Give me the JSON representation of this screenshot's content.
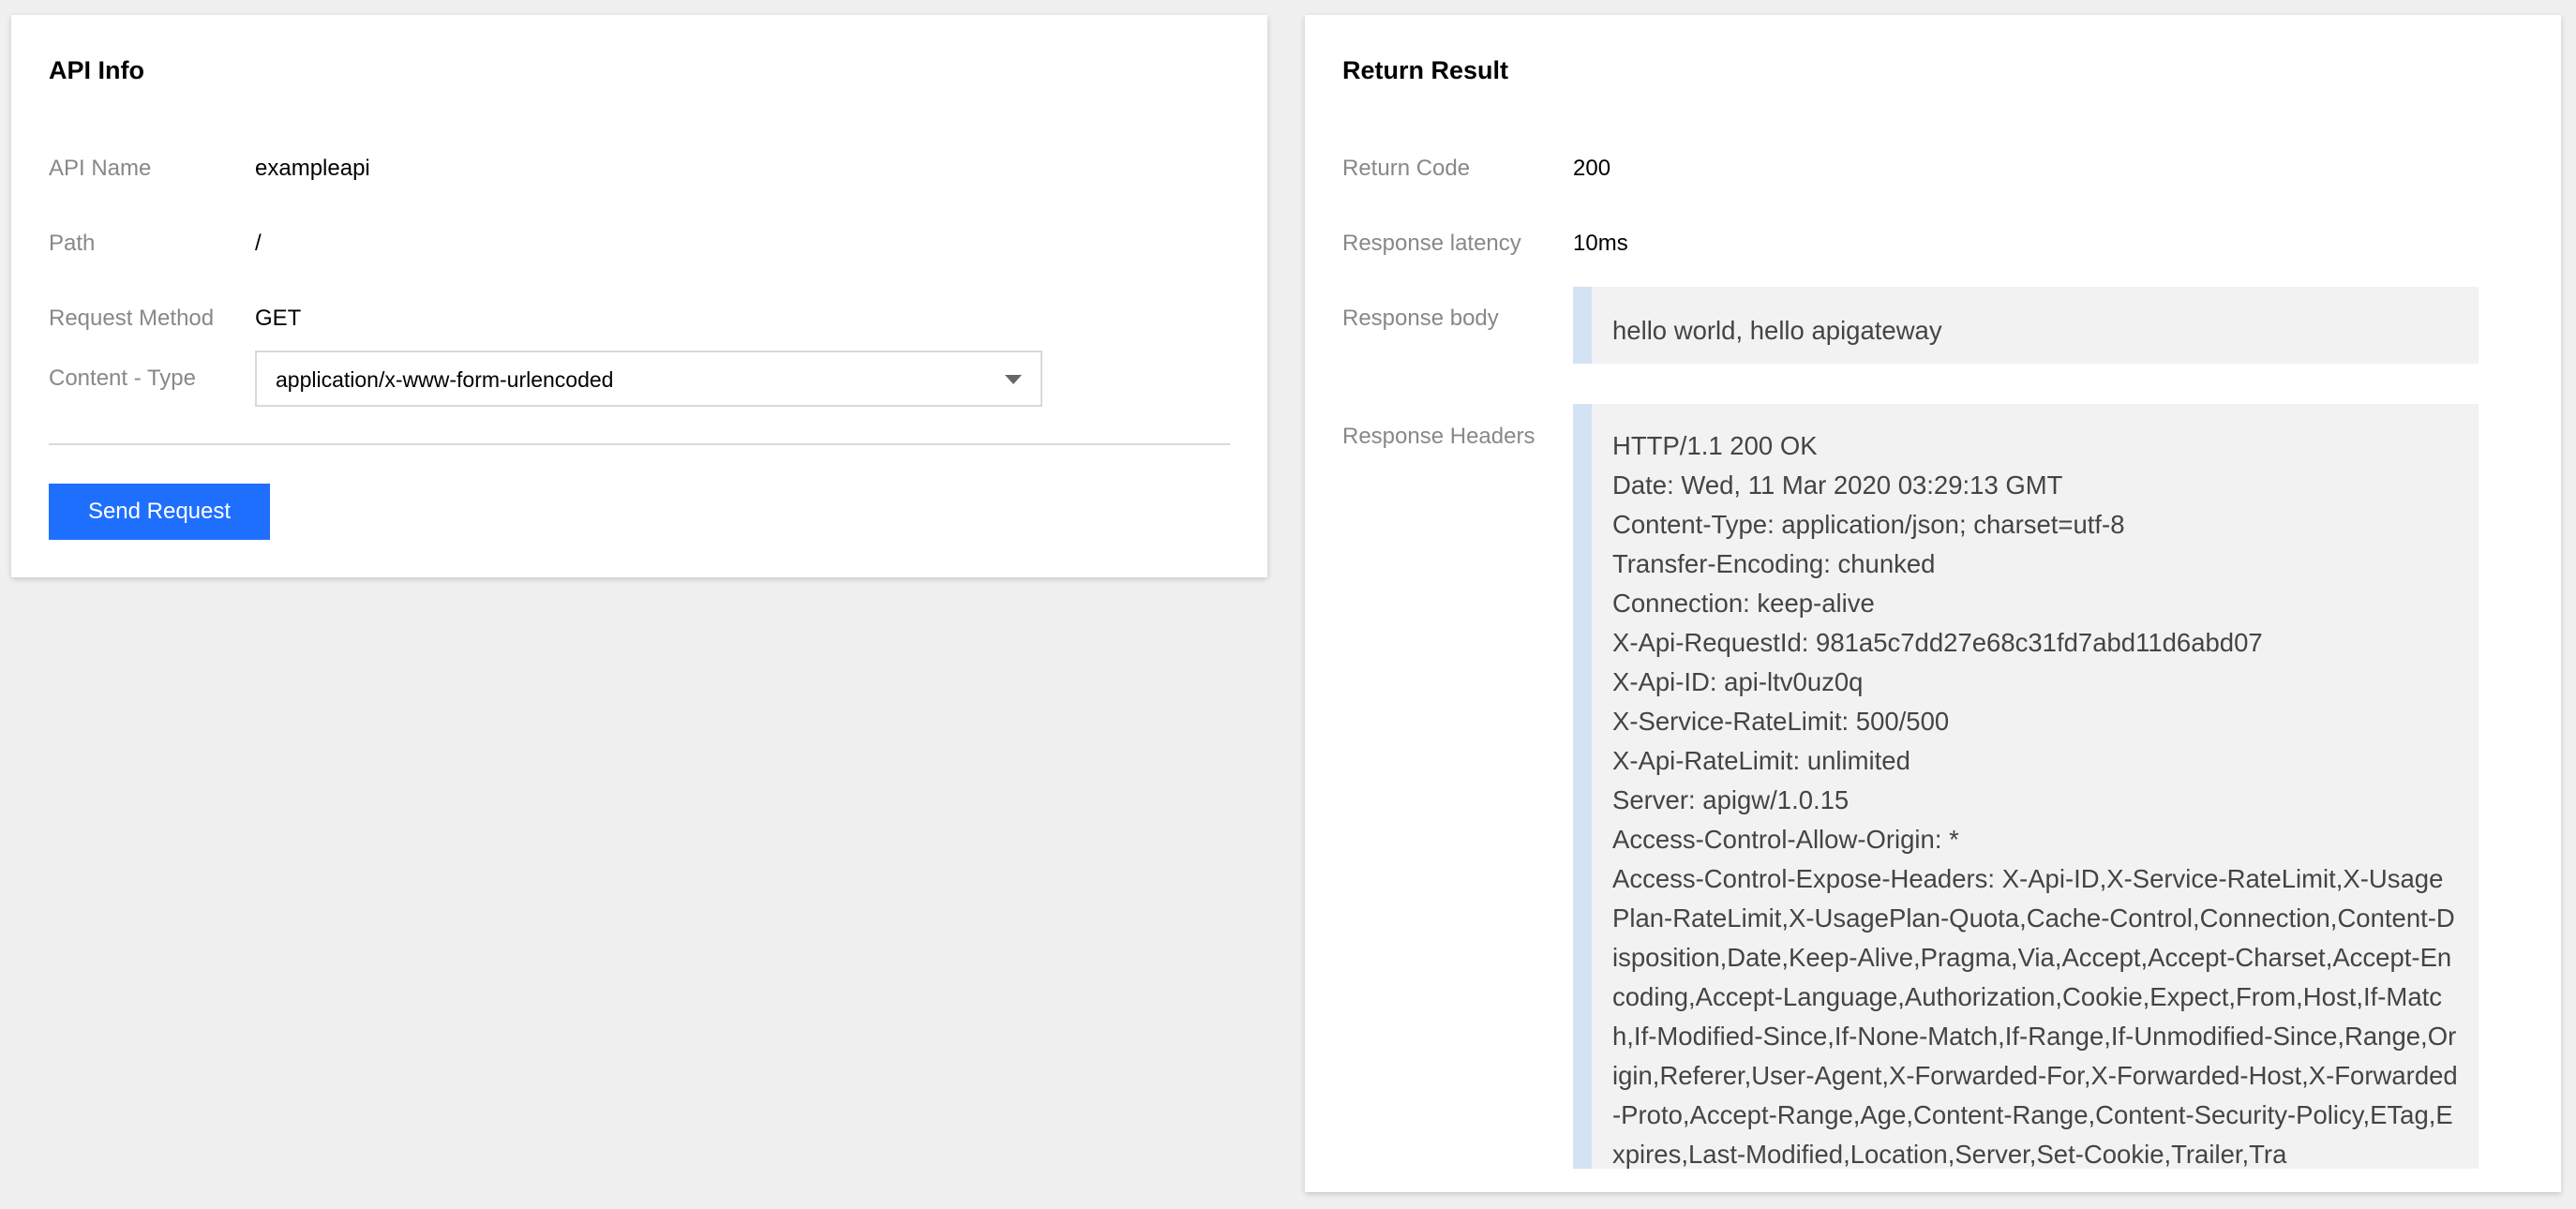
{
  "api_info": {
    "title": "API Info",
    "api_name_label": "API Name",
    "api_name_value": "exampleapi",
    "path_label": "Path",
    "path_value": "/",
    "method_label": "Request Method",
    "method_value": "GET",
    "content_type_label": "Content - Type",
    "content_type_value": "application/x-www-form-urlencoded",
    "send_button_label": "Send Request"
  },
  "return_result": {
    "title": "Return Result",
    "return_code_label": "Return Code",
    "return_code_value": "200",
    "latency_label": "Response latency",
    "latency_value": "10ms",
    "body_label": "Response body",
    "body_value": "hello world, hello apigateway",
    "headers_label": "Response Headers",
    "headers": [
      "HTTP/1.1 200 OK",
      "Date: Wed, 11 Mar 2020 03:29:13 GMT",
      "Content-Type: application/json; charset=utf-8",
      "Transfer-Encoding: chunked",
      "Connection: keep-alive",
      "X-Api-RequestId: 981a5c7dd27e68c31fd7abd11d6abd07",
      "X-Api-ID: api-ltv0uz0q",
      "X-Service-RateLimit: 500/500",
      "X-Api-RateLimit: unlimited",
      "Server: apigw/1.0.15",
      "Access-Control-Allow-Origin: *",
      "Access-Control-Expose-Headers: X-Api-ID,X-Service-RateLimit,X-UsagePlan-RateLimit,X-UsagePlan-Quota,Cache-Control,Connection,Content-Disposition,Date,Keep-Alive,Pragma,Via,Accept,Accept-Charset,Accept-Encoding,Accept-Language,Authorization,Cookie,Expect,From,Host,If-Match,If-Modified-Since,If-None-Match,If-Range,If-Unmodified-Since,Range,Origin,Referer,User-Agent,X-Forwarded-For,X-Forwarded-Host,X-Forwarded-Proto,Accept-Range,Age,Content-Range,Content-Security-Policy,ETag,Expires,Last-Modified,Location,Server,Set-Cookie,Trailer,Tra"
    ]
  },
  "colors": {
    "primary_button": "#1f6fff",
    "code_background": "#f2f2f2",
    "code_accent_bar": "#d3e3f3"
  },
  "icons": {
    "dropdown": "caret-down-icon"
  }
}
